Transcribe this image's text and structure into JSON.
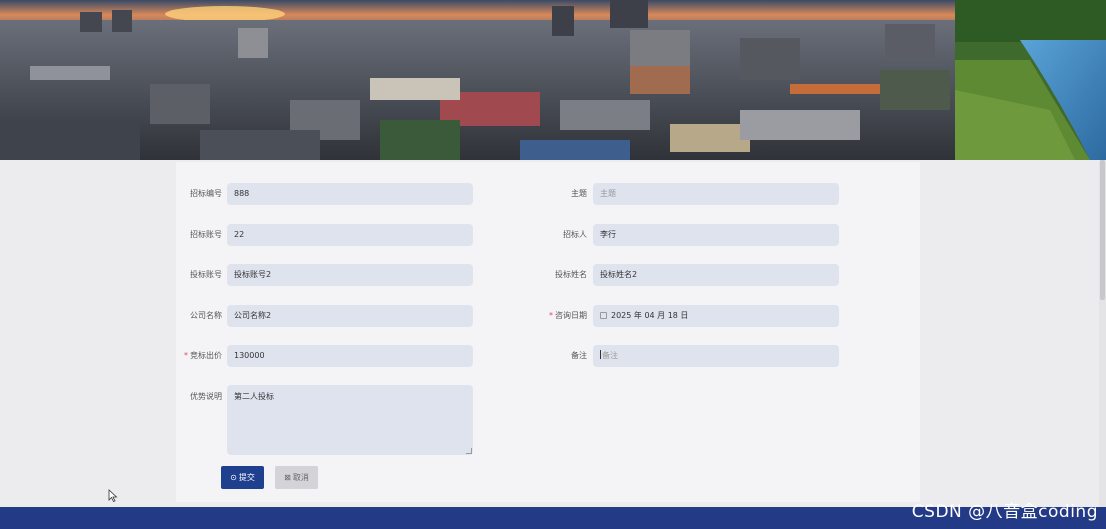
{
  "form": {
    "left_fields": [
      {
        "label": "招标编号",
        "value": "888",
        "required": false
      },
      {
        "label": "招标账号",
        "value": "22",
        "required": false
      },
      {
        "label": "投标账号",
        "value": "投标账号2",
        "required": false
      },
      {
        "label": "公司名称",
        "value": "公司名称2",
        "required": false
      },
      {
        "label": "竞标出价",
        "value": "130000",
        "required": true
      }
    ],
    "right_fields": [
      {
        "label": "主题",
        "value": "主题",
        "required": false,
        "is_placeholder": true
      },
      {
        "label": "招标人",
        "value": "李行",
        "required": false
      },
      {
        "label": "投标姓名",
        "value": "投标姓名2",
        "required": false
      },
      {
        "label": "咨询日期",
        "value": "2025 年 04 月 18 日",
        "required": true
      },
      {
        "label": "备注",
        "value": "备注",
        "required": false,
        "is_placeholder": true
      }
    ],
    "advantage": {
      "label": "优势说明",
      "value": "第二人投标"
    },
    "required_mark": "*",
    "buttons": {
      "submit": "提交",
      "cancel": "取消"
    }
  },
  "watermark": "CSDN @八音盒coding",
  "colors": {
    "footer": "#233a86",
    "submit_button": "#1f3f8f",
    "field_bg": "#dfe3ee",
    "required": "#e05050"
  }
}
